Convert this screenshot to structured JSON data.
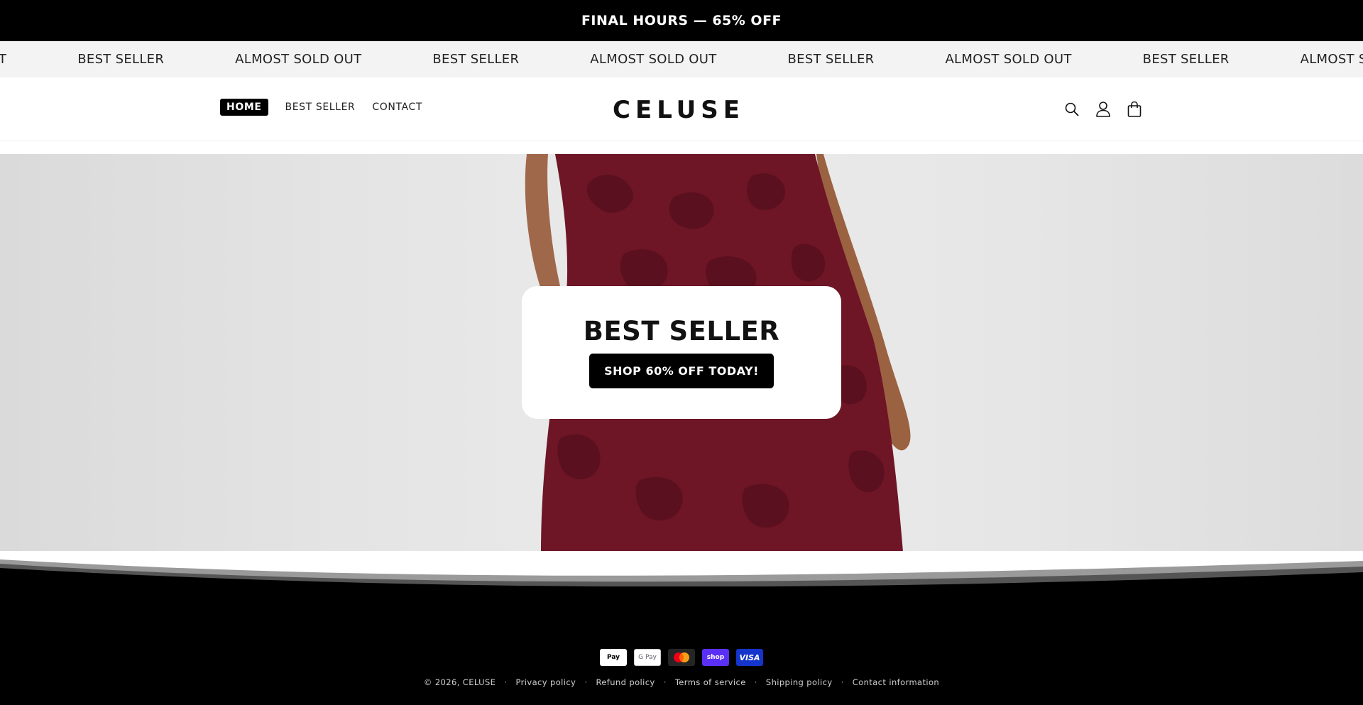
{
  "announcement": {
    "text": "FINAL HOURS — 65% OFF"
  },
  "marquee": {
    "items": [
      "OUT",
      "BEST SELLER",
      "ALMOST SOLD OUT",
      "BEST SELLER",
      "ALMOST SOLD OUT",
      "BEST SELLER",
      "ALMOST SOLD OUT",
      "BEST SELLER",
      "ALMOST SOLD OUT"
    ]
  },
  "header": {
    "nav": [
      {
        "label": "HOME",
        "active": true
      },
      {
        "label": "BEST SELLER",
        "active": false
      },
      {
        "label": "CONTACT",
        "active": false
      }
    ],
    "logo": "CELUSE",
    "icons": [
      "search-icon",
      "account-icon",
      "cart-icon"
    ]
  },
  "hero": {
    "title": "BEST SELLER",
    "cta_label": "SHOP 60% OFF TODAY!",
    "dress_color": "#6e1526"
  },
  "footer": {
    "payments": [
      {
        "name": "apple-pay-icon",
        "label": "Pay"
      },
      {
        "name": "google-pay-icon",
        "label": "G Pay"
      },
      {
        "name": "mastercard-icon",
        "label": ""
      },
      {
        "name": "shop-pay-icon",
        "label": "shop"
      },
      {
        "name": "visa-icon",
        "label": "VISA"
      }
    ],
    "copyright": "© 2026, CELUSE",
    "links": [
      "Privacy policy",
      "Refund policy",
      "Terms of service",
      "Shipping policy",
      "Contact information"
    ]
  }
}
